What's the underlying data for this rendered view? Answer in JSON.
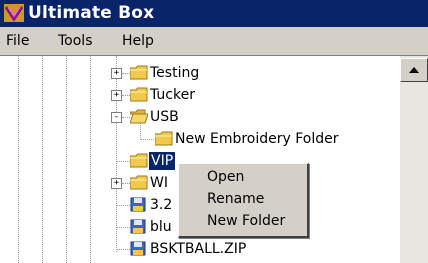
{
  "window": {
    "title": "Ultimate Box"
  },
  "menu": [
    "File",
    "Tools",
    "Help"
  ],
  "tree": {
    "items": [
      {
        "label": "Testing",
        "expander": "+",
        "type": "folder"
      },
      {
        "label": "Tucker",
        "expander": "+",
        "type": "folder"
      },
      {
        "label": "USB",
        "expander": "-",
        "type": "folder-open"
      },
      {
        "label": "New Embroidery Folder",
        "type": "folder"
      },
      {
        "label": "VIP",
        "type": "folder",
        "selected": true
      },
      {
        "label": "WI",
        "expander": "+",
        "type": "folder"
      },
      {
        "label": "3.2",
        "type": "disk"
      },
      {
        "label": "blu",
        "type": "disk"
      },
      {
        "label": "BSKTBALL.ZIP",
        "type": "disk"
      }
    ]
  },
  "context_menu": {
    "items": [
      "Open",
      "Rename",
      "New Folder"
    ]
  },
  "colors": {
    "titlebar": "#0a246a",
    "menubar": "#d4d0c8",
    "folder": "#f2c94c",
    "selection": "#0a246a"
  }
}
